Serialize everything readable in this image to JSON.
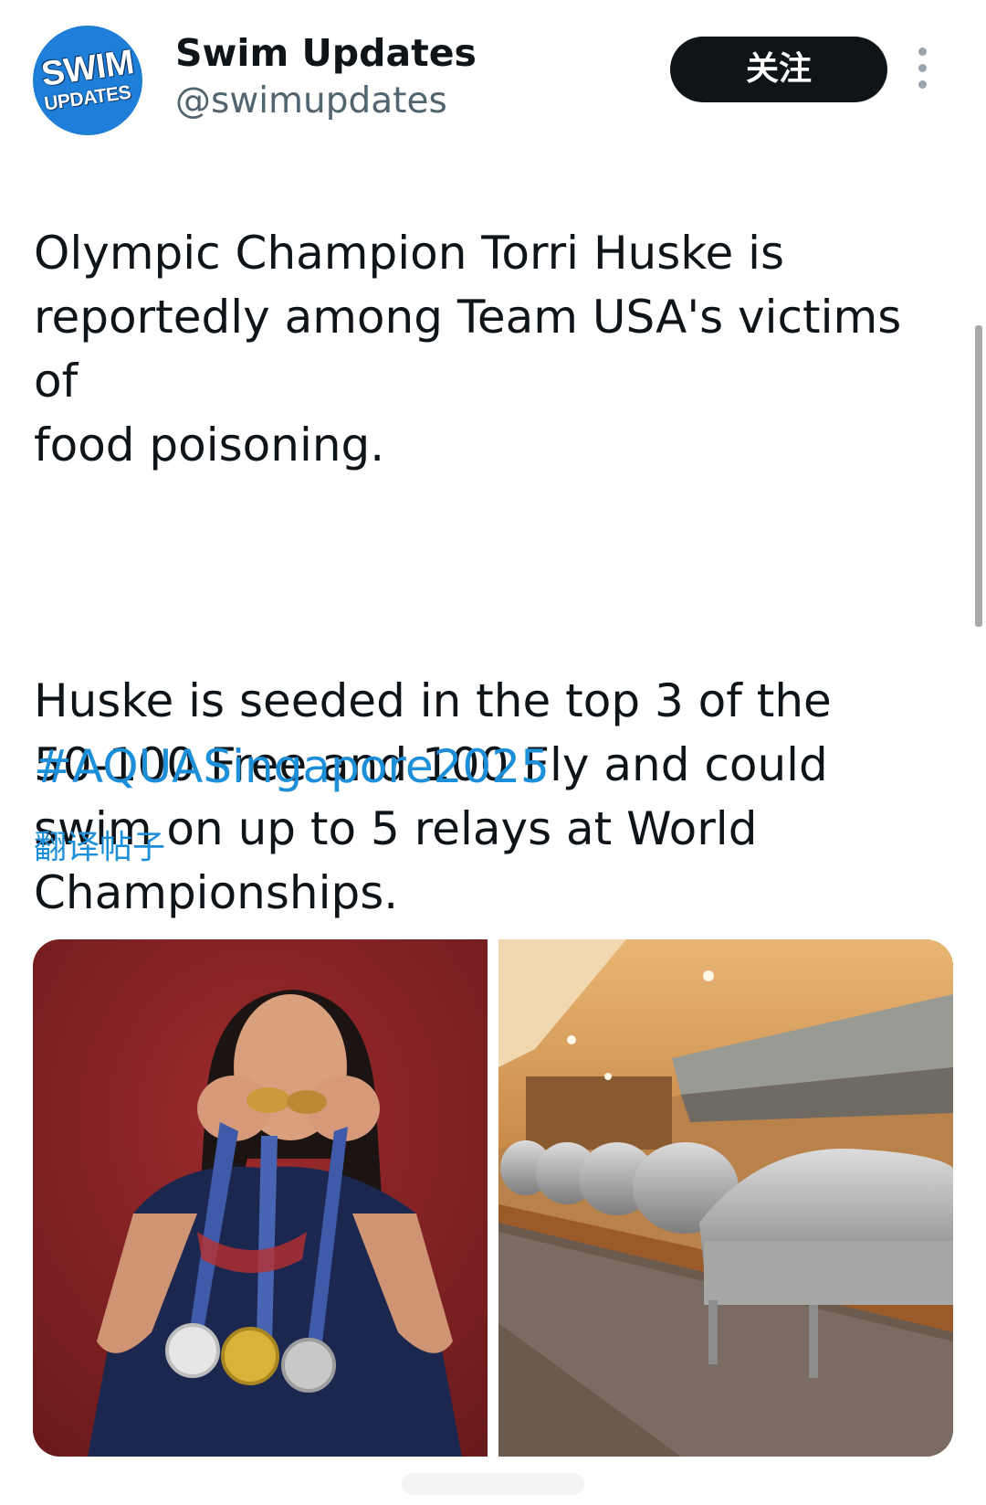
{
  "account": {
    "name": "Swim Updates",
    "handle": "@swimupdates",
    "avatar_lines": [
      "SWIM",
      "UPDATES"
    ]
  },
  "header": {
    "follow_label": "关注",
    "more_icon": "more-vertical-icon"
  },
  "post": {
    "paragraph1": "Olympic Champion Torri Huske is\nreportedly among Team USA's victims of\nfood poisoning.",
    "paragraph2": "Huske is seeded in the top 3 of the\n50-100 Free and 100 Fly and could\nswim on up to 5 relays at World\nChampionships.",
    "hashtag": "#AQUASingapore2025",
    "translate_label": "翻译帖子"
  },
  "media": [
    {
      "alt": "athlete biting medals photo"
    },
    {
      "alt": "buffet chafing dishes photo"
    }
  ],
  "colors": {
    "link": "#1d8fd8",
    "follow_bg": "#0f1419",
    "avatar": "#1d7fd8"
  }
}
